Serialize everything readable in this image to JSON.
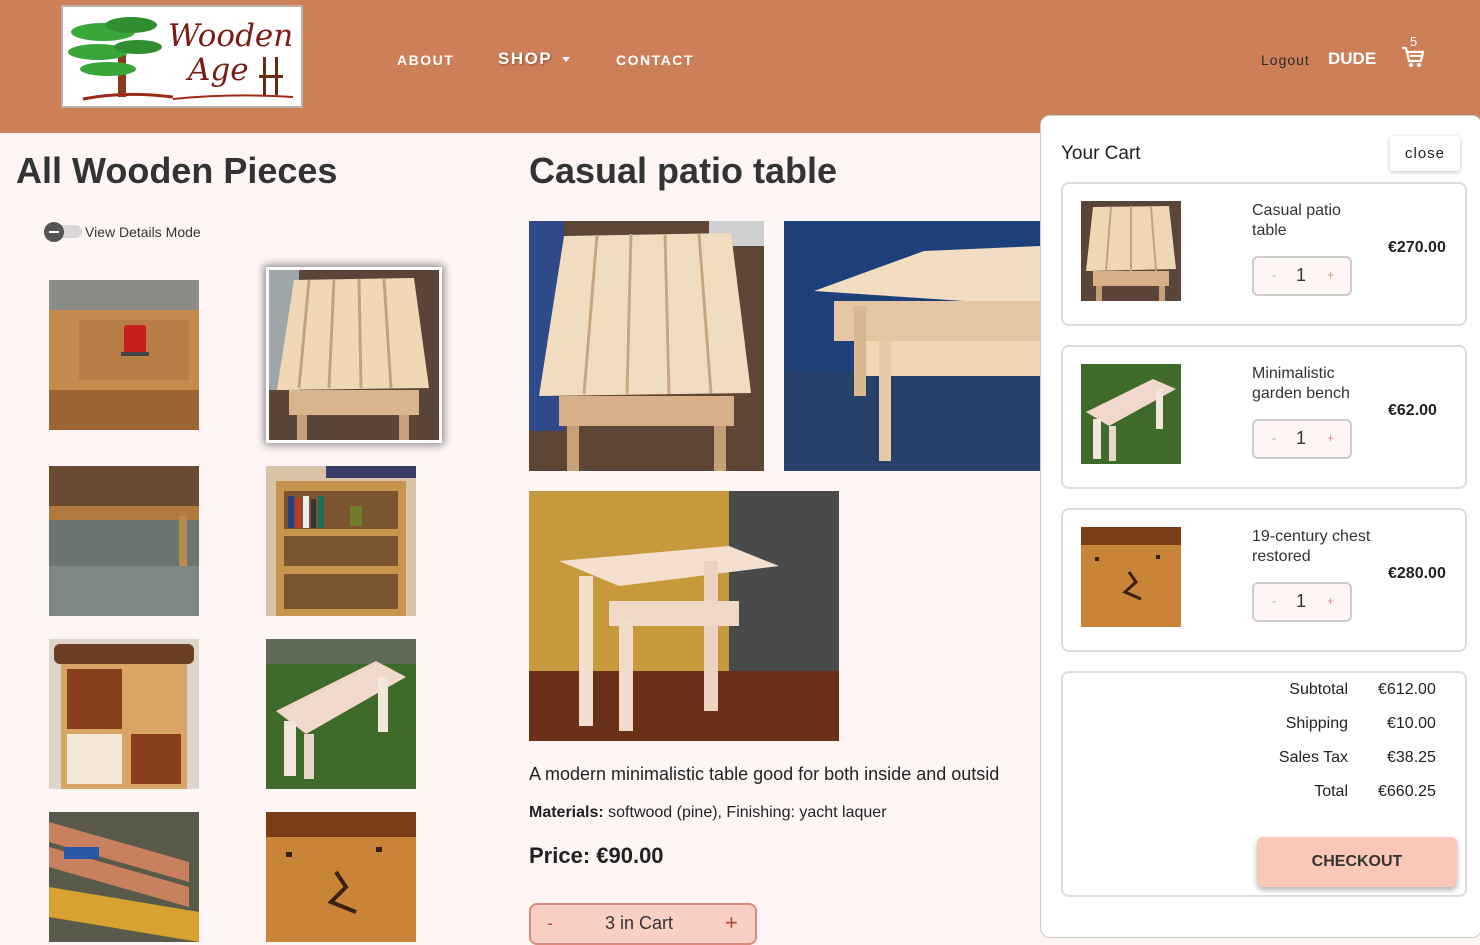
{
  "header": {
    "logo": {
      "line1": "Wooden",
      "line2": "Age"
    },
    "nav": {
      "about": "ABOUT",
      "shop": "SHOP",
      "contact": "CONTACT"
    },
    "logout": "Logout",
    "user": "DUDE",
    "cart_count": "5"
  },
  "gallery": {
    "title": "All Wooden Pieces",
    "toggle_label": "View Details Mode"
  },
  "product": {
    "title": "Casual patio table",
    "description": "A modern minimalistic table good for both inside and outsid",
    "materials_label": "Materials:",
    "materials_text": " softwood (pine), Finishing: yacht laquer",
    "price": "Price: €90.00",
    "cart": {
      "minus": "-",
      "label": "3 in Cart",
      "plus": "+"
    }
  },
  "cart": {
    "title": "Your Cart",
    "close": "close",
    "items": [
      {
        "name": "Casual patio table",
        "qty": "1",
        "price": "€270.00",
        "minus": "-",
        "plus": "+"
      },
      {
        "name": "Minimalistic garden bench",
        "qty": "1",
        "price": "€62.00",
        "minus": "-",
        "plus": "+"
      },
      {
        "name": "19-century chest restored",
        "qty": "1",
        "price": "€280.00",
        "minus": "-",
        "plus": "+"
      }
    ],
    "totals": {
      "subtotal_label": "Subtotal",
      "subtotal": "€612.00",
      "shipping_label": "Shipping",
      "shipping": "€10.00",
      "tax_label": "Sales Tax",
      "tax": "€38.25",
      "total_label": "Total",
      "total": "€660.25"
    },
    "checkout": "CHECKOUT"
  }
}
